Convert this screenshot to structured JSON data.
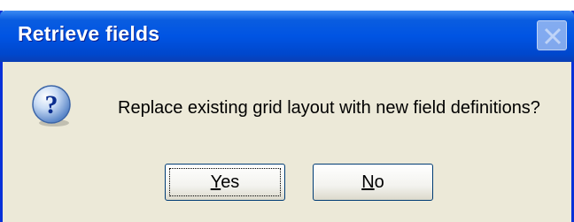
{
  "window": {
    "title": "Retrieve fields",
    "close_icon": "close-icon"
  },
  "message": {
    "icon": "question-icon",
    "text": "Replace existing grid layout with new field definitions?"
  },
  "buttons": {
    "yes": {
      "mnemonic": "Y",
      "rest": "es"
    },
    "no": {
      "mnemonic": "N",
      "rest": "o"
    }
  }
}
